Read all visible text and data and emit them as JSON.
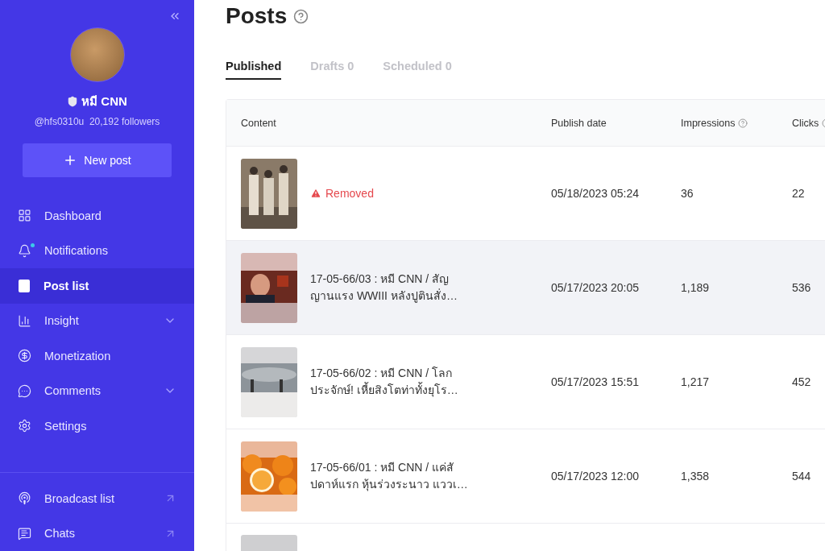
{
  "sidebar": {
    "profile": {
      "name": "หมี CNN",
      "verified": true,
      "handle": "@hfs0310u",
      "followers": "20,192 followers"
    },
    "new_post": "New post",
    "items": [
      {
        "label": "Dashboard",
        "selected": false,
        "expandable": false,
        "dot": false
      },
      {
        "label": "Notifications",
        "selected": false,
        "expandable": false,
        "dot": true
      },
      {
        "label": "Post list",
        "selected": true,
        "expandable": false,
        "dot": false
      },
      {
        "label": "Insight",
        "selected": false,
        "expandable": true,
        "dot": false
      },
      {
        "label": "Monetization",
        "selected": false,
        "expandable": false,
        "dot": false
      },
      {
        "label": "Comments",
        "selected": false,
        "expandable": true,
        "dot": false
      },
      {
        "label": "Settings",
        "selected": false,
        "expandable": false,
        "dot": false
      }
    ],
    "links": [
      {
        "label": "Broadcast list",
        "external": true
      },
      {
        "label": "Chats",
        "external": true
      }
    ]
  },
  "page": {
    "title": "Posts",
    "tabs": [
      {
        "label": "Published",
        "selected": true
      },
      {
        "label": "Drafts 0",
        "selected": false
      },
      {
        "label": "Scheduled 0",
        "selected": false
      }
    ],
    "table": {
      "columns": [
        "Content",
        "Publish date",
        "Impressions",
        "Clicks"
      ],
      "rows": [
        {
          "kind": "full",
          "highlighted": false,
          "status": "Removed",
          "title_lines": [],
          "date": "05/18/2023 05:24",
          "impressions": "36",
          "clicks": "22"
        },
        {
          "kind": "full",
          "highlighted": true,
          "title_lines": [
            "17-05-66/03 : หมี CNN / สัญ",
            "ญานแรง WWIII หลังปูตินสั่ง…"
          ],
          "date": "05/17/2023 20:05",
          "impressions": "1,189",
          "clicks": "536"
        },
        {
          "kind": "full",
          "highlighted": false,
          "title_lines": [
            "17-05-66/02 : หมี CNN / โลก",
            "ประจักษ์! เหี้ยสิงโตท่าทั้งยุโร…"
          ],
          "date": "05/17/2023 15:51",
          "impressions": "1,217",
          "clicks": "452"
        },
        {
          "kind": "full",
          "highlighted": false,
          "title_lines": [
            "17-05-66/01 : หมี CNN / แค่สั",
            "ปดาห์แรก หุ้นร่วงระนาว แววเ…"
          ],
          "date": "05/17/2023 12:00",
          "impressions": "1,358",
          "clicks": "544"
        },
        {
          "kind": "partial",
          "highlighted": false
        }
      ]
    }
  }
}
